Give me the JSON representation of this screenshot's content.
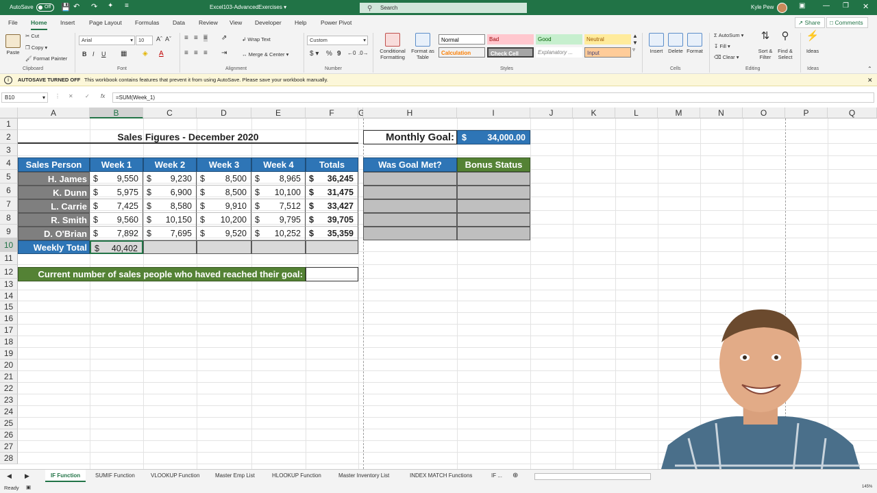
{
  "titlebar": {
    "autosave_label": "AutoSave",
    "autosave_state": "Off",
    "filename": "Excel103-AdvancedExercises",
    "search_placeholder": "Search",
    "user_name": "Kyle Pew"
  },
  "menu": {
    "tabs": [
      "File",
      "Home",
      "Insert",
      "Page Layout",
      "Formulas",
      "Data",
      "Review",
      "View",
      "Developer",
      "Help",
      "Power Pivot"
    ],
    "active": "Home",
    "share_label": "Share",
    "comments_label": "Comments"
  },
  "ribbon": {
    "clipboard": {
      "paste": "Paste",
      "cut": "Cut",
      "copy": "Copy",
      "format_painter": "Format Painter",
      "label": "Clipboard"
    },
    "font": {
      "name": "Arial",
      "size": "10",
      "label": "Font"
    },
    "alignment": {
      "wrap": "Wrap Text",
      "merge": "Merge & Center",
      "label": "Alignment"
    },
    "number": {
      "format": "Custom",
      "label": "Number"
    },
    "styles": {
      "conditional": "Conditional Formatting",
      "format_as_table": "Format as Table",
      "cells": [
        {
          "text": "Normal",
          "bg": "#ffffff",
          "fg": "#000000"
        },
        {
          "text": "Bad",
          "bg": "#ffc7ce",
          "fg": "#9c0006"
        },
        {
          "text": "Good",
          "bg": "#c6efce",
          "fg": "#006100"
        },
        {
          "text": "Neutral",
          "bg": "#ffeb9c",
          "fg": "#9c5700"
        },
        {
          "text": "Calculation",
          "bg": "#f2f2f2",
          "fg": "#fa7d00"
        },
        {
          "text": "Check Cell",
          "bg": "#a5a5a5",
          "fg": "#ffffff"
        },
        {
          "text": "Explanatory ...",
          "bg": "#ffffff",
          "fg": "#7f7f7f"
        },
        {
          "text": "Input",
          "bg": "#ffcc99",
          "fg": "#3f3f76"
        }
      ],
      "label": "Styles"
    },
    "cells": {
      "insert": "Insert",
      "delete": "Delete",
      "format": "Format",
      "label": "Cells"
    },
    "editing": {
      "autosum": "AutoSum",
      "fill": "Fill",
      "clear": "Clear",
      "sort": "Sort & Filter",
      "find": "Find & Select",
      "label": "Editing"
    },
    "ideas": {
      "btn": "Ideas",
      "label": "Ideas"
    }
  },
  "infobar": {
    "title": "AUTOSAVE TURNED OFF",
    "message": "This workbook contains features that prevent it from using AutoSave. Please save your workbook manually."
  },
  "formula": {
    "namebox": "B10",
    "content": "=SUM(Week_1)"
  },
  "columns": [
    "A",
    "B",
    "C",
    "D",
    "E",
    "F",
    "G",
    "H",
    "I",
    "J",
    "K",
    "L",
    "M",
    "N",
    "O",
    "P",
    "Q"
  ],
  "rows": [
    "1",
    "2",
    "3",
    "4",
    "5",
    "6",
    "7",
    "8",
    "9",
    "10",
    "11",
    "12",
    "13",
    "14",
    "15",
    "16",
    "17",
    "18",
    "19",
    "20",
    "21",
    "22",
    "23",
    "24",
    "25",
    "26",
    "27",
    "28"
  ],
  "sheet": {
    "title": "Sales Figures - December 2020",
    "goal_label": "Monthly Goal:",
    "goal_currency": "$",
    "goal_value": "34,000.00",
    "headers": [
      "Sales Person",
      "Week 1",
      "Week 2",
      "Week 3",
      "Week 4",
      "Totals"
    ],
    "right_headers": [
      "Was Goal Met?",
      "Bonus Status"
    ],
    "currency": "$",
    "people": [
      {
        "name": "H. James",
        "w1": "9,550",
        "w2": "9,230",
        "w3": "8,500",
        "w4": "8,965",
        "total": "36,245"
      },
      {
        "name": "K. Dunn",
        "w1": "5,975",
        "w2": "6,900",
        "w3": "8,500",
        "w4": "10,100",
        "total": "31,475"
      },
      {
        "name": "L. Carrie",
        "w1": "7,425",
        "w2": "8,580",
        "w3": "9,910",
        "w4": "7,512",
        "total": "33,427"
      },
      {
        "name": "R. Smith",
        "w1": "9,560",
        "w2": "10,150",
        "w3": "10,200",
        "w4": "9,795",
        "total": "39,705"
      },
      {
        "name": "D. O'Brian",
        "w1": "7,892",
        "w2": "7,695",
        "w3": "9,520",
        "w4": "10,252",
        "total": "35,359"
      }
    ],
    "weekly_total_label": "Weekly Total",
    "weekly_total_value": "40,402",
    "current_label": "Current number of sales people who haved reached their goal:"
  },
  "sheet_tabs": [
    "IF Function",
    "SUMIF Function",
    "VLOOKUP Function",
    "Master Emp List",
    "HLOOKUP Function",
    "Master Inventory List",
    "INDEX MATCH Functions",
    "IF ..."
  ],
  "active_sheet": "IF Function",
  "status": {
    "ready": "Ready",
    "zoom": "145%"
  }
}
